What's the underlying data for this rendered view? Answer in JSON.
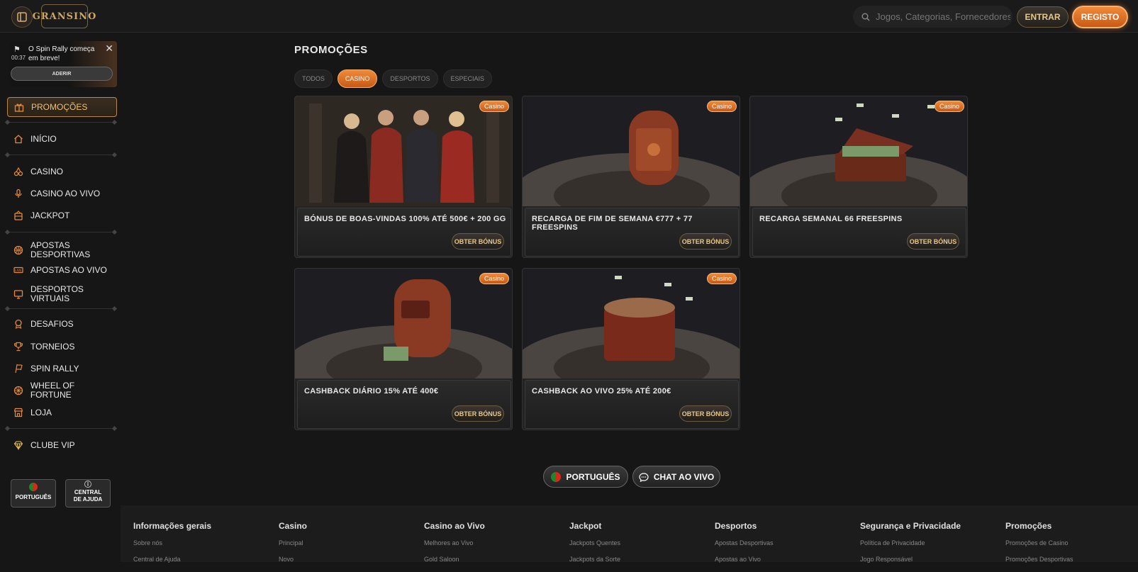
{
  "header": {
    "logo_text": "GRANSINO",
    "search_placeholder": "Jogos, Categorias, Fornecedores",
    "login_label": "ENTRAR",
    "register_label": "REGISTO"
  },
  "rally_banner": {
    "text": "O Spin Rally começa em breve!",
    "timer": "00:37",
    "join_label": "ADERIR"
  },
  "sidebar": {
    "items": [
      {
        "label": "PROMOÇÕES",
        "icon": "gift-icon"
      },
      {
        "label": "INÍCIO",
        "icon": "home-icon"
      },
      {
        "label": "CASINO",
        "icon": "cherries-icon"
      },
      {
        "label": "CASINO AO VIVO",
        "icon": "microphone-icon"
      },
      {
        "label": "JACKPOT",
        "icon": "jackpot-icon"
      },
      {
        "label": "APOSTAS DESPORTIVAS",
        "icon": "basketball-icon"
      },
      {
        "label": "APOSTAS AO VIVO",
        "icon": "live-icon"
      },
      {
        "label": "DESPORTOS VIRTUAIS",
        "icon": "virtual-icon"
      },
      {
        "label": "DESAFIOS",
        "icon": "medal-icon"
      },
      {
        "label": "TORNEIOS",
        "icon": "trophy-icon"
      },
      {
        "label": "SPIN RALLY",
        "icon": "flag-icon"
      },
      {
        "label": "WHEEL OF FORTUNE",
        "icon": "wheel-icon"
      },
      {
        "label": "LOJA",
        "icon": "shop-icon"
      },
      {
        "label": "CLUBE VIP",
        "icon": "diamond-icon"
      }
    ],
    "language_label": "PORTUGUÊS",
    "help_label": "CENTRAL DE AJUDA"
  },
  "main": {
    "title": "PROMOÇÕES",
    "tabs": [
      "TODOS",
      "CASINO",
      "DESPORTOS",
      "ESPECIAIS"
    ],
    "active_tab": "CASINO",
    "cards": [
      {
        "badge": "Casino",
        "title": "BÓNUS DE BOAS-VINDAS 100% ATÉ 500€ + 200 GG",
        "button": "OBTER BÓNUS"
      },
      {
        "badge": "Casino",
        "title": "RECARGA DE FIM DE SEMANA €777 + 77 FREESPINS",
        "button": "OBTER BÓNUS"
      },
      {
        "badge": "Casino",
        "title": "RECARGA SEMANAL 66 FREESPINS",
        "button": "OBTER BÓNUS"
      },
      {
        "badge": "Casino",
        "title": "CASHBACK DIÁRIO 15% ATÉ 400€",
        "button": "OBTER BÓNUS"
      },
      {
        "badge": "Casino",
        "title": "CASHBACK AO VIVO 25% ATÉ 200€",
        "button": "OBTER BÓNUS"
      }
    ],
    "language_button": "PORTUGUÊS",
    "chat_button": "CHAT AO VIVO"
  },
  "footer": {
    "columns": [
      {
        "title": "Informações gerais",
        "links": [
          "Sobre nós",
          "Central de Ajuda"
        ]
      },
      {
        "title": "Casino",
        "links": [
          "Principal",
          "Novo"
        ]
      },
      {
        "title": "Casino ao Vivo",
        "links": [
          "Melhores ao Vivo",
          "Gold Saloon"
        ]
      },
      {
        "title": "Jackpot",
        "links": [
          "Jackpots Quentes",
          "Jackpots da Sorte"
        ]
      },
      {
        "title": "Desportos",
        "links": [
          "Apostas Desportivas",
          "Apostas ao Vivo"
        ]
      },
      {
        "title": "Segurança e Privacidade",
        "links": [
          "Política de Privacidade",
          "Jogo Responsável"
        ]
      },
      {
        "title": "Promoções",
        "links": [
          "Promoções de Casino",
          "Promoções Desportivas"
        ]
      }
    ]
  },
  "colors": {
    "accent": "#e8893a",
    "gold": "#c9a86a",
    "background": "#161616"
  }
}
